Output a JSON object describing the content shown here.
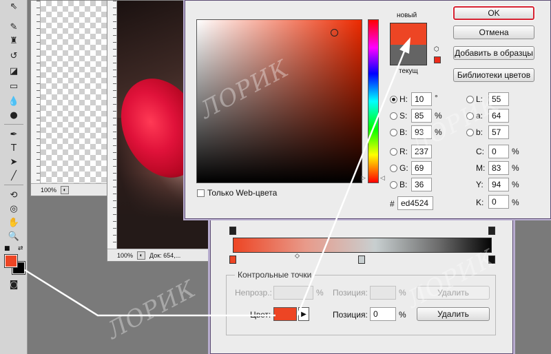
{
  "colors": {
    "accent": "#ed4524",
    "current": "#646464",
    "ok_border": "#d62030"
  },
  "tools": {
    "icons": [
      "move-icon",
      "brush-icon",
      "clone-stamp-icon",
      "history-brush-icon",
      "eraser-icon",
      "gradient-icon",
      "blur-icon",
      "dodge-icon",
      "pen-icon",
      "type-icon",
      "path-select-icon",
      "shape-icon",
      "3d-rotate-icon",
      "3d-orbit-icon",
      "hand-icon",
      "zoom-icon"
    ],
    "type_glyph": "T"
  },
  "doc1": {
    "zoom": "100%"
  },
  "doc2": {
    "zoom": "100%",
    "info": "Док: 654,..."
  },
  "picker": {
    "new_label": "новый",
    "current_label": "текущ",
    "buttons": {
      "ok": "OK",
      "cancel": "Отмена",
      "add_swatch": "Добавить в образцы",
      "libraries": "Библиотеки цветов"
    },
    "hsb": [
      {
        "key": "H:",
        "value": "10",
        "unit": "°",
        "selected": true
      },
      {
        "key": "S:",
        "value": "85",
        "unit": "%",
        "selected": false
      },
      {
        "key": "B:",
        "value": "93",
        "unit": "%",
        "selected": false
      }
    ],
    "rgb": [
      {
        "key": "R:",
        "value": "237"
      },
      {
        "key": "G:",
        "value": "69"
      },
      {
        "key": "B:",
        "value": "36"
      }
    ],
    "lab": [
      {
        "key": "L:",
        "value": "55"
      },
      {
        "key": "a:",
        "value": "64"
      },
      {
        "key": "b:",
        "value": "57"
      }
    ],
    "cmyk": [
      {
        "key": "C:",
        "value": "0",
        "unit": "%"
      },
      {
        "key": "M:",
        "value": "83",
        "unit": "%"
      },
      {
        "key": "Y:",
        "value": "94",
        "unit": "%"
      },
      {
        "key": "K:",
        "value": "0",
        "unit": "%"
      }
    ],
    "hex_label": "#",
    "hex_value": "ed4524",
    "web_only_label": "Только Web-цвета"
  },
  "gradient_editor": {
    "stops_title": "Контрольные точки",
    "opacity_label": "Непрозр.:",
    "percent": "%",
    "position_label": "Позиция:",
    "delete_label": "Удалить",
    "color_label": "Цвет:",
    "position_value": "0"
  },
  "watermark": "ЛОРИК"
}
